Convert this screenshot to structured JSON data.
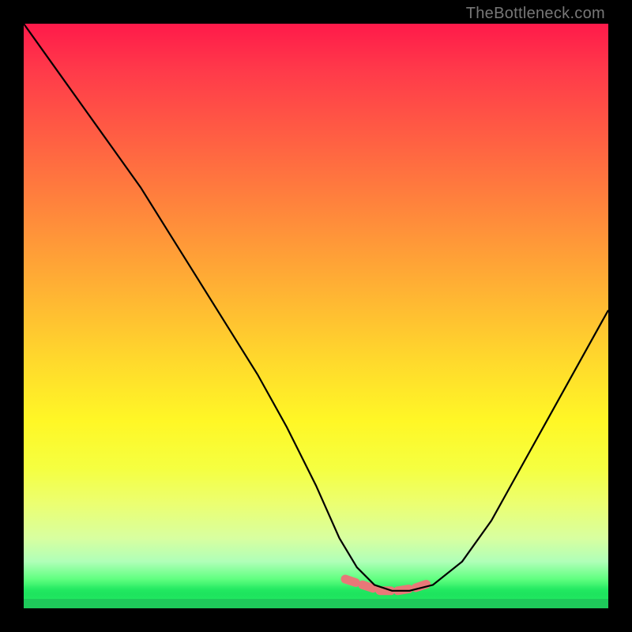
{
  "watermark": "TheBottleneck.com",
  "chart_data": {
    "type": "line",
    "title": "",
    "xlabel": "",
    "ylabel": "",
    "xlim": [
      0,
      100
    ],
    "ylim": [
      0,
      100
    ],
    "gradient_meaning": "vertical background encodes match quality: top (red) = high bottleneck, bottom (green) = no bottleneck",
    "series": [
      {
        "name": "bottleneck-curve",
        "x": [
          0,
          5,
          10,
          15,
          20,
          25,
          30,
          35,
          40,
          45,
          50,
          54,
          57,
          60,
          63,
          66,
          70,
          75,
          80,
          85,
          90,
          95,
          100
        ],
        "y": [
          100,
          93,
          86,
          79,
          72,
          64,
          56,
          48,
          40,
          31,
          21,
          12,
          7,
          4,
          3,
          3,
          4,
          8,
          15,
          24,
          33,
          42,
          51
        ]
      },
      {
        "name": "optimal-flat-region",
        "x": [
          55,
          58,
          61,
          64,
          67,
          70
        ],
        "y": [
          5,
          4,
          3,
          3,
          3.5,
          4.5
        ]
      }
    ],
    "annotations": []
  }
}
